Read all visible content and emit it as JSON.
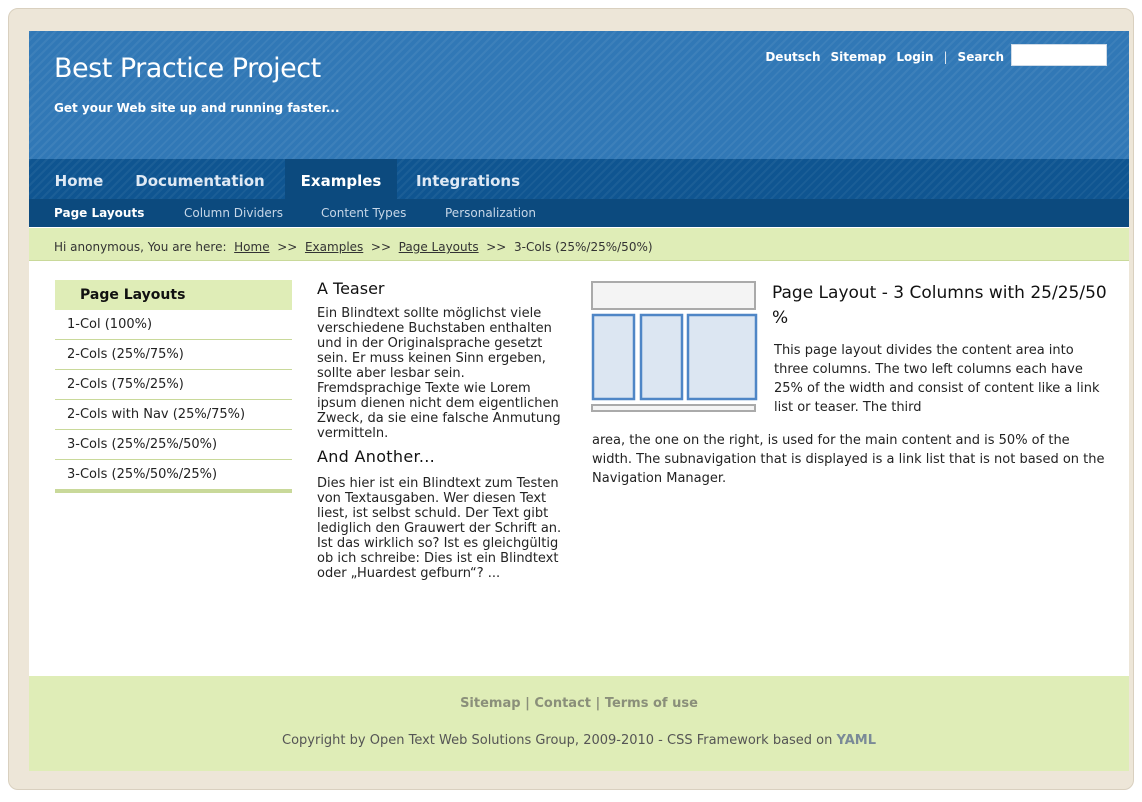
{
  "header": {
    "title": "Best Practice Project",
    "subtitle": "Get your Web site up and running faster...",
    "top_links": [
      "Deutsch",
      "Sitemap",
      "Login"
    ],
    "separator": "|",
    "search_label": "Search",
    "search_value": ""
  },
  "main_nav": {
    "tabs": [
      "Home",
      "Documentation",
      "Examples",
      "Integrations"
    ],
    "active": "Examples"
  },
  "sub_nav": {
    "items": [
      "Page Layouts",
      "Column Dividers",
      "Content Types",
      "Personalization"
    ],
    "active": "Page Layouts"
  },
  "breadcrumb": {
    "greeting": "Hi anonymous, You are here:",
    "sep": ">>",
    "links": [
      "Home",
      "Examples",
      "Page Layouts"
    ],
    "current": "3-Cols (25%/25%/50%)"
  },
  "sidebar": {
    "title": "Page Layouts",
    "items": [
      "1-Col (100%)",
      "2-Cols (25%/75%)",
      "2-Cols (75%/25%)",
      "2-Cols with Nav (25%/75%)",
      "3-Cols (25%/25%/50%)",
      "3-Cols (25%/50%/25%)"
    ]
  },
  "teaser": {
    "heading1": "A Teaser",
    "text1": "Ein Blindtext sollte möglichst viele verschiedene Buchstaben enthalten und in der Originalsprache gesetzt sein. Er muss keinen Sinn ergeben, sollte aber lesbar sein. Fremdsprachige Texte wie Lorem ipsum dienen nicht dem eigentlichen Zweck, da sie eine falsche Anmutung vermitteln.",
    "heading2": "And Another...",
    "text2": "Dies hier ist ein Blindtext zum Testen von Textausgaben. Wer diesen Text liest, ist selbst schuld. Der Text gibt lediglich den Grauwert der Schrift an. Ist das wirklich so? Ist es gleichgültig ob ich schreibe: Dies ist ein Blindtext oder „Huardest gefburn“? ..."
  },
  "main": {
    "title": "Page Layout - 3 Columns with 25/25/50 %",
    "text_a": "This page layout divides the content area into three columns. The two left columns each have 25% of the width and consist of content like a link list or teaser. The third",
    "text_b": "area, the one on the right, is used for the main content and is 50% of the width. The subnavigation that is displayed is a link list that is not based on the Navigation Manager."
  },
  "footer": {
    "links": [
      "Sitemap",
      "Contact",
      "Terms of use"
    ],
    "sep": "|",
    "copyright": "Copyright by Open Text Web Solutions Group, 2009-2010 - CSS Framework based on",
    "yaml": "YAML"
  },
  "colors": {
    "header_blue": "#3178b6",
    "nav_blue": "#0f5591",
    "subnav_blue": "#0c4a7e",
    "accent_green": "#dfedb7",
    "figure_blue": "#4f86c6",
    "figure_fill": "#dce6f2"
  }
}
